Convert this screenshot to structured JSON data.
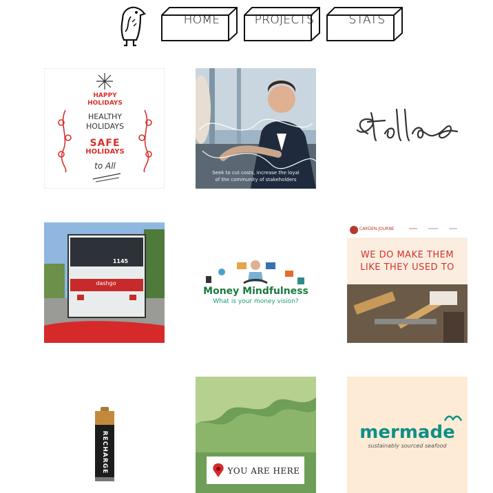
{
  "nav": {
    "items": [
      {
        "label": "HOME"
      },
      {
        "label": "PROJECTS"
      },
      {
        "label": "STATS"
      }
    ]
  },
  "tiles": {
    "holiday": {
      "line1": "HAPPY",
      "line2": "HOLIDAYS",
      "line3": "HEALTHY",
      "line4": "HOLIDAYS",
      "line5": "SAFE",
      "line6": "HOLIDAYS",
      "line7": "to All"
    },
    "meeting": {
      "caption_line1": "Seek to cut costs, increase the loyal",
      "caption_line2": "of the community of stakeholders"
    },
    "stella": {
      "signature": "Stella"
    },
    "bus": {
      "number": "1145",
      "brand": "dashgo"
    },
    "money": {
      "title": "Money Mindfulness",
      "subtitle": "What is your money vision?"
    },
    "carpenter": {
      "brand": "CARDEN JOURNE",
      "headline_line1": "WE DO MAKE THEM",
      "headline_line2": "LIKE THEY USED TO"
    },
    "battery": {
      "label": "RECHARGE"
    },
    "here": {
      "label": "YOU ARE HERE"
    },
    "mermade": {
      "title": "mermade",
      "tagline": "sustainably sourced seafood"
    }
  },
  "colors": {
    "accent_red": "#d6302b",
    "teal": "#0e8f86",
    "money_green": "#1a7a3d",
    "here_green": "#6e9e57",
    "peach": "#fdebd6"
  }
}
